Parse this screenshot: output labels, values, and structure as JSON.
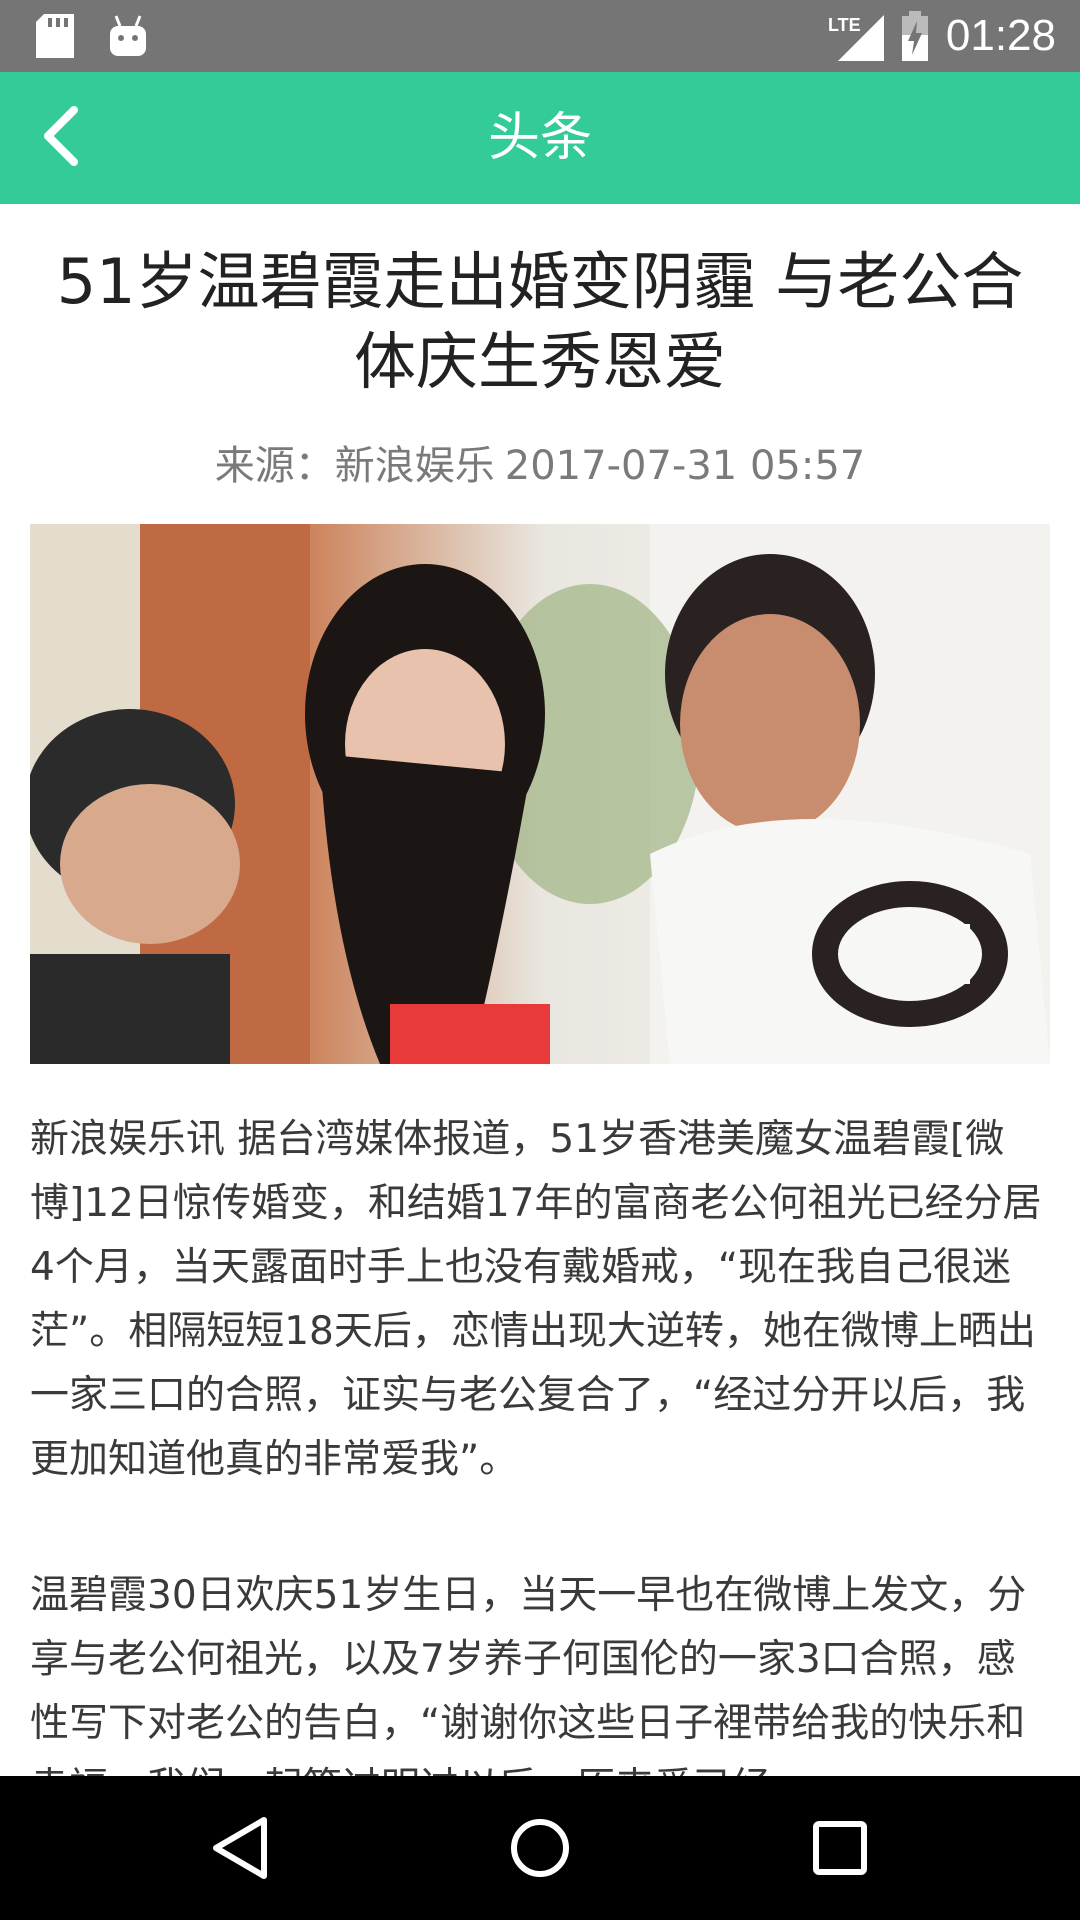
{
  "status_bar": {
    "time": "01:28",
    "icons": [
      "sd-card-icon",
      "android-icon",
      "lte-signal-icon",
      "battery-charging-icon"
    ],
    "network_label": "LTE"
  },
  "app_bar": {
    "title": "头条",
    "back_icon": "chevron-left-icon",
    "color": "#33cc99"
  },
  "article": {
    "title": "51岁温碧霞走出婚变阴霾 与老公合体庆生秀恩爱",
    "source": "来源：新浪娱乐",
    "datetime": "2017-07-31 05:57",
    "image_alt": "photo",
    "paragraphs": [
      "新浪娱乐讯 据台湾媒体报道，51岁香港美魔女温碧霞[微博]12日惊传婚变，和结婚17年的富商老公何祖光已经分居4个月，当天露面时手上也没有戴婚戒，“现在我自己很迷茫”。相隔短短18天后，恋情出现大逆转，她在微博上晒出一家三口的合照，证实与老公复合了，“经过分开以后，我更加知道他真的非常爱我”。",
      "温碧霞30日欢庆51岁生日，当天一早也在微博上发文，分享与老公何祖光，以及7岁养子何国伦的一家3口合照，感性写下对老公的告白，“谢谢你这些日子裡带给我的快乐和幸福，我们一起等过明过以后，原来爱已经"
    ]
  },
  "nav_bar": {
    "buttons": [
      "back-triangle-icon",
      "home-circle-icon",
      "recents-square-icon"
    ]
  }
}
